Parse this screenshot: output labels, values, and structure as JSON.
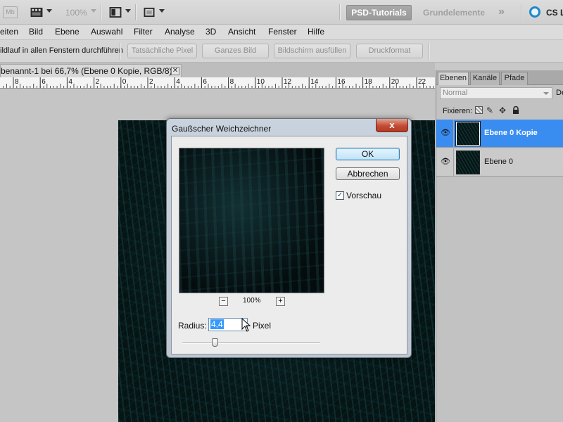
{
  "app": {
    "mb_label": "Mb",
    "zoom_display": "100%",
    "workspaces": {
      "active": "PSD-Tutorials",
      "other": "Grundelemente",
      "more": "»"
    },
    "cs_live": "CS Live"
  },
  "menu": [
    "eiten",
    "Bild",
    "Ebene",
    "Auswahl",
    "Filter",
    "Analyse",
    "3D",
    "Ansicht",
    "Fenster",
    "Hilfe"
  ],
  "options": {
    "label": "ildlauf in allen Fenstern durchführen",
    "buttons": [
      "Tatsächliche Pixel",
      "Ganzes Bild",
      "Bildschirm ausfüllen",
      "Druckformat"
    ]
  },
  "document": {
    "tab_title": "benannt-1 bei 66,7% (Ebene 0 Kopie, RGB/8) *",
    "close_glyph": "✕"
  },
  "ruler": {
    "labels": [
      "8",
      "6",
      "4",
      "2",
      "0",
      "2",
      "4",
      "6",
      "8",
      "10",
      "12",
      "14",
      "16",
      "18",
      "20",
      "22"
    ]
  },
  "layers_panel": {
    "tabs": [
      "Ebenen",
      "Kanäle",
      "Pfade"
    ],
    "blend_mode": "Normal",
    "opacity_label": "De",
    "lock_label": "Fixieren:",
    "layers": [
      {
        "name": "Ebene 0 Kopie",
        "selected": true
      },
      {
        "name": "Ebene 0",
        "selected": false
      }
    ]
  },
  "dialog": {
    "title": "Gaußscher Weichzeichner",
    "close": "x",
    "ok": "OK",
    "cancel": "Abbrechen",
    "preview_label": "Vorschau",
    "preview_checked": true,
    "zoom_minus": "−",
    "zoom_plus": "+",
    "zoom_value": "100%",
    "radius_label": "Radius:",
    "radius_value": "4,4",
    "radius_unit": "Pixel"
  }
}
